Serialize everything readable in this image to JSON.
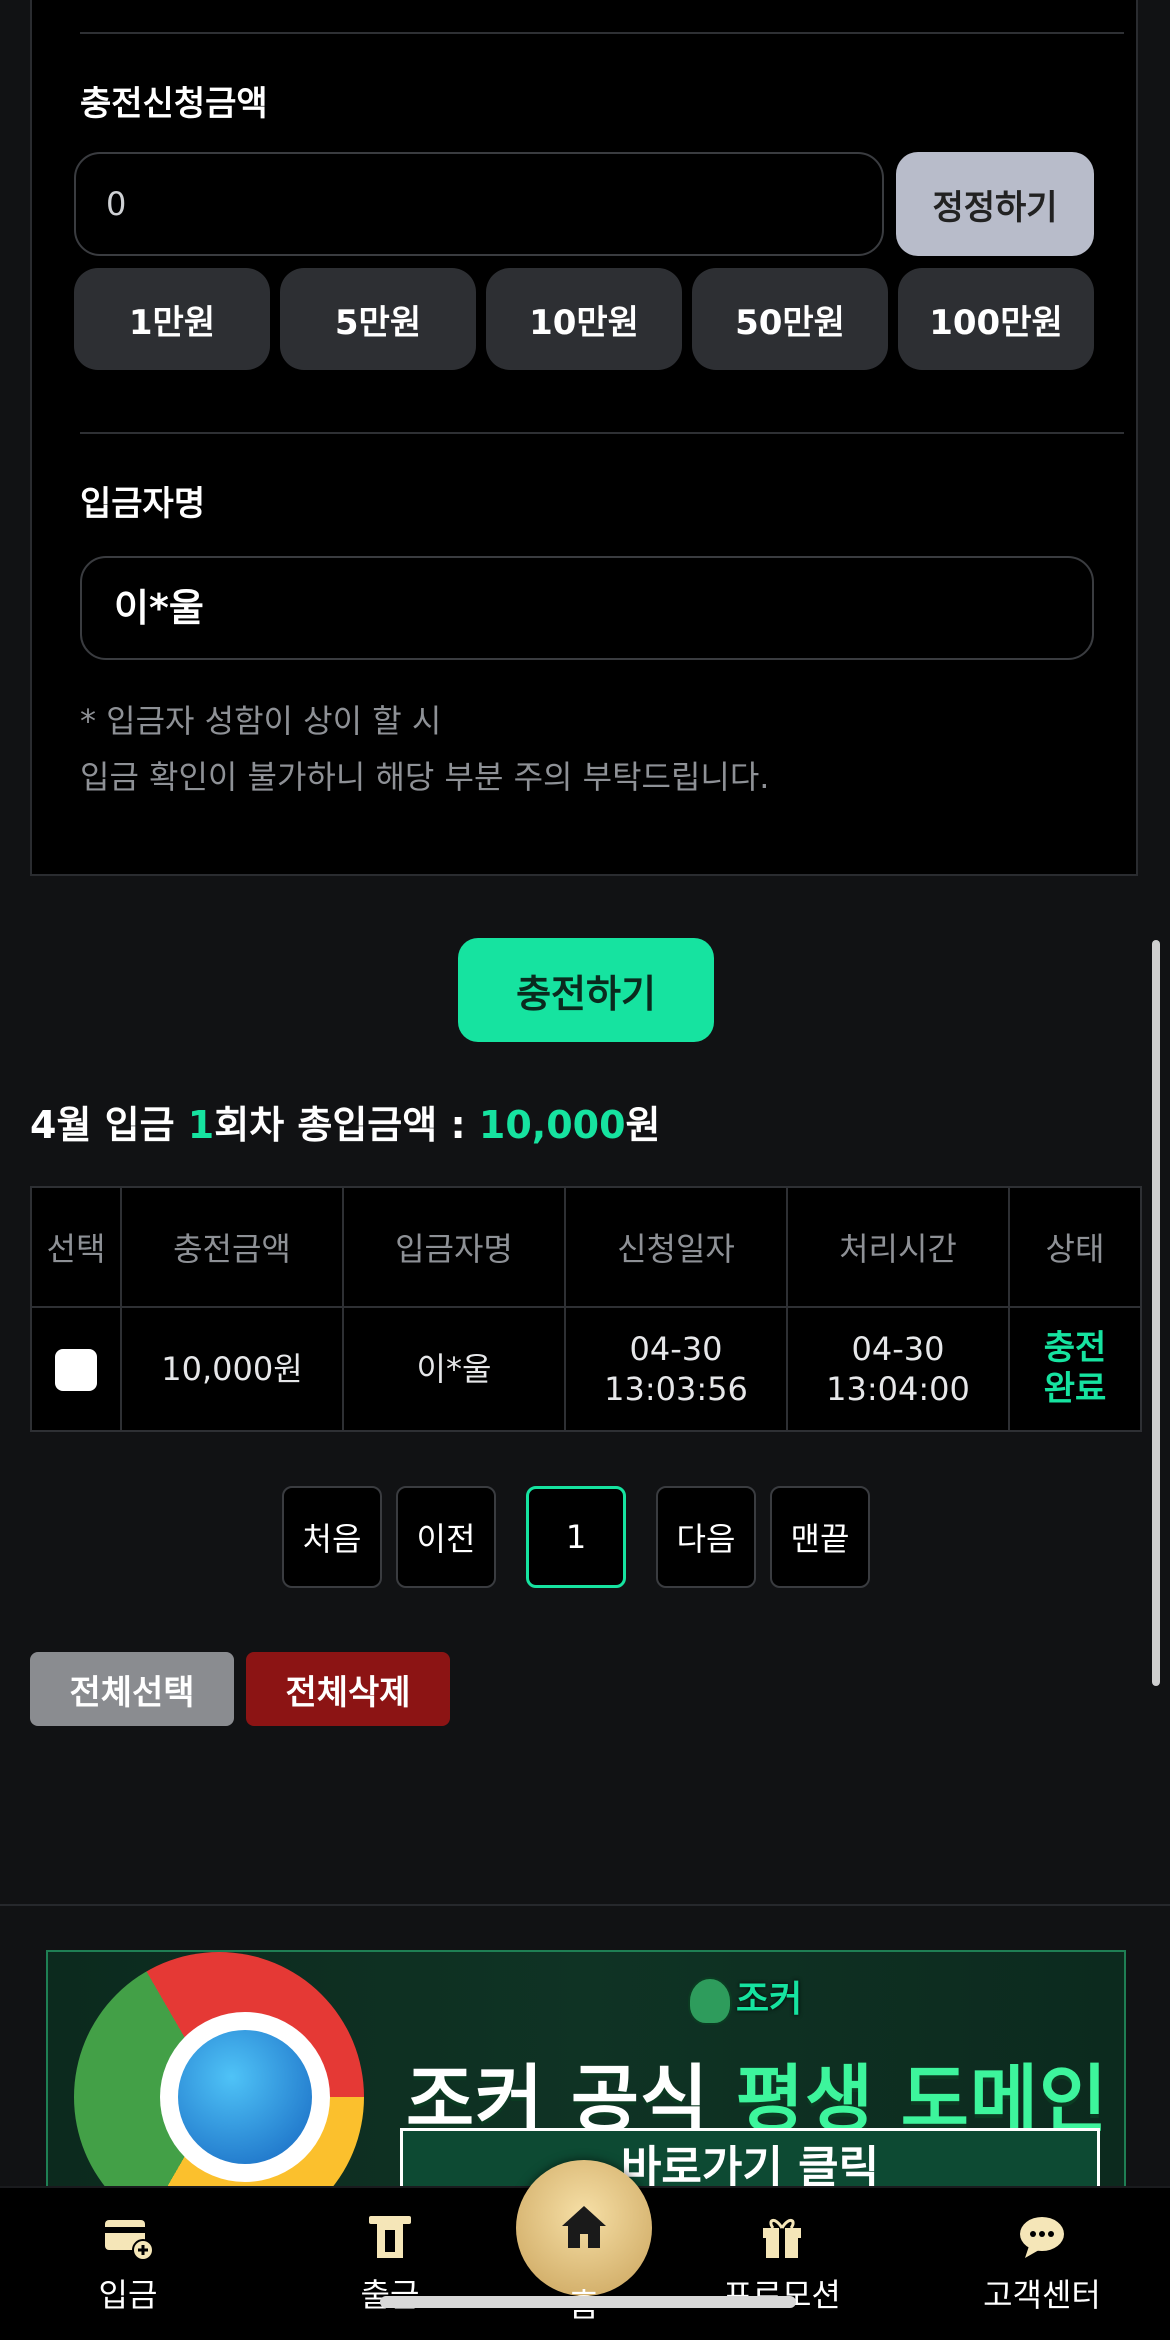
{
  "form": {
    "amount_label": "충전신청금액",
    "amount_value": "0",
    "reset_label": "정정하기",
    "quick_amounts": [
      "1만원",
      "5만원",
      "10만원",
      "50만원",
      "100만원"
    ],
    "depositor_label": "입금자명",
    "depositor_value": "이*울",
    "notice_line1": "* 입금자 성함이 상이 할 시",
    "notice_line2": "입금 확인이 불가하니 해당 부분 주의 부탁드립니다."
  },
  "charge_button": "충전하기",
  "summary": {
    "prefix": "4월 입금 ",
    "count": "1",
    "middle": "회차 총입금액 : ",
    "total": "10,000",
    "suffix": "원"
  },
  "table": {
    "headers": [
      "선택",
      "충전금액",
      "입금자명",
      "신청일자",
      "처리시간",
      "상태"
    ],
    "rows": [
      {
        "amount": "10,000원",
        "depositor": "이*울",
        "request_date": "04-30",
        "request_time": "13:03:56",
        "process_date": "04-30",
        "process_time": "13:04:00",
        "status_line1": "충전",
        "status_line2": "완료"
      }
    ]
  },
  "pagination": {
    "first": "처음",
    "prev": "이전",
    "current": "1",
    "next": "다음",
    "last": "맨끝"
  },
  "actions": {
    "select_all": "전체선택",
    "delete_all": "전체삭제"
  },
  "banner": {
    "logo_text": "조커",
    "title_white1": "조커 공식 ",
    "title_green": "평생 도메인",
    "cta": "바로가기 클릭"
  },
  "bottom_nav": {
    "deposit": "입금",
    "withdraw": "출금",
    "home": "홈",
    "promotion": "프로모션",
    "support": "고객센터"
  },
  "colors": {
    "accent": "#16e3a0",
    "danger": "#8c1414",
    "background": "#111214"
  }
}
